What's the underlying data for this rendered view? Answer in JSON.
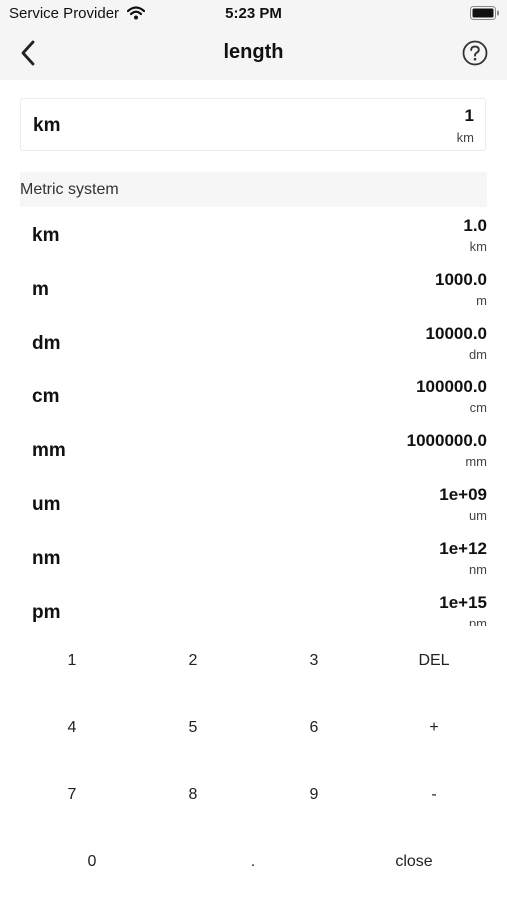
{
  "status_bar": {
    "carrier": "Service Provider",
    "time": "5:23 PM"
  },
  "nav": {
    "title": "length"
  },
  "input": {
    "unit": "km",
    "value": "1",
    "suffix": "km"
  },
  "section": {
    "title": "Metric system"
  },
  "units": [
    {
      "name": "km",
      "value": "1.0",
      "suffix": "km"
    },
    {
      "name": "m",
      "value": "1000.0",
      "suffix": "m"
    },
    {
      "name": "dm",
      "value": "10000.0",
      "suffix": "dm"
    },
    {
      "name": "cm",
      "value": "100000.0",
      "suffix": "cm"
    },
    {
      "name": "mm",
      "value": "1000000.0",
      "suffix": "mm"
    },
    {
      "name": "um",
      "value": "1e+09",
      "suffix": "um"
    },
    {
      "name": "nm",
      "value": "1e+12",
      "suffix": "nm"
    },
    {
      "name": "pm",
      "value": "1e+15",
      "suffix": "pm"
    }
  ],
  "keypad": {
    "k1": "1",
    "k2": "2",
    "k3": "3",
    "del": "DEL",
    "k4": "4",
    "k5": "5",
    "k6": "6",
    "plus": "+",
    "k7": "7",
    "k8": "8",
    "k9": "9",
    "minus": "-",
    "k0": "0",
    "dot": ".",
    "close": "close"
  },
  "icons": {
    "wifi": "wifi-icon",
    "battery": "battery-icon",
    "back": "chevron-left-icon",
    "help": "question-circle-icon"
  }
}
